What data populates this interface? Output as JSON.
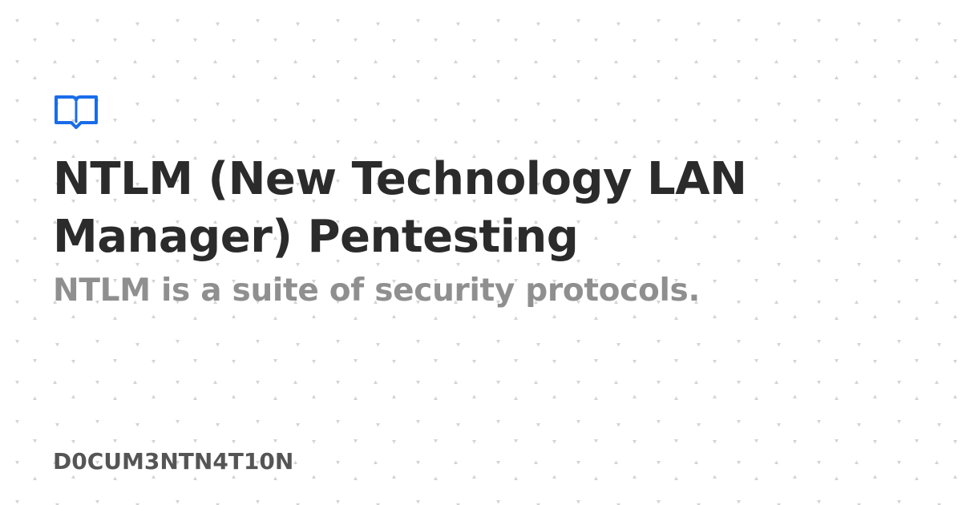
{
  "card": {
    "title": "NTLM (New Technology LAN Manager) Pentesting",
    "description": "NTLM is a suite of security protocols.",
    "site_name": "D0CUM3NTN4T10N",
    "logo_icon": "open-book-icon"
  },
  "colors": {
    "background": "#ffffff",
    "title": "#2b2b2b",
    "description": "#8f8f8f",
    "site_name": "#555555",
    "accent": "#1a6ce8",
    "pattern": "#d6d6d6"
  }
}
